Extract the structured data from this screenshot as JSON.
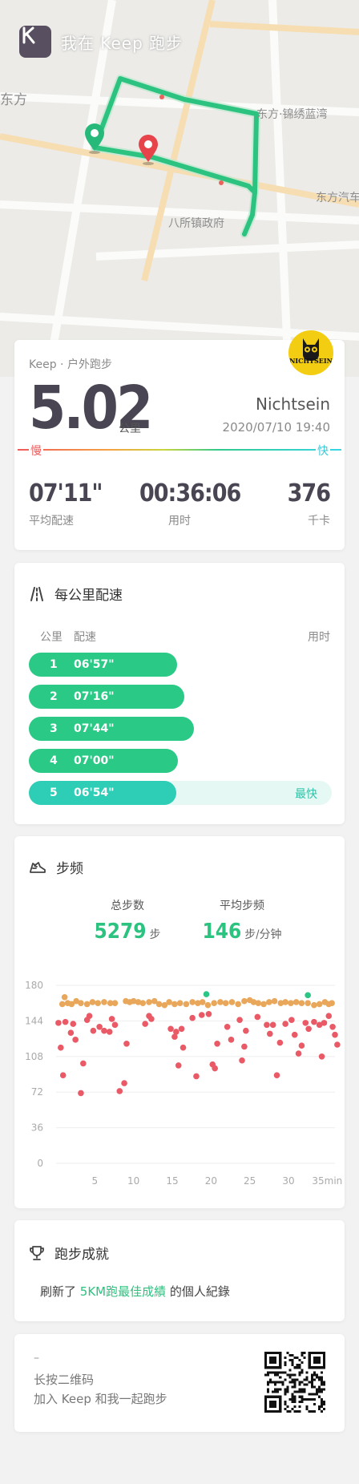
{
  "header": {
    "app_title": "我在 Keep 跑步",
    "map_labels": [
      "东方",
      "东方·锦绣蓝湾",
      "东方汽车",
      "八所镇政府"
    ]
  },
  "summary": {
    "source": "Keep · 户外跑步",
    "distance": "5.02",
    "distance_unit": "公里",
    "username": "Nichtsein",
    "avatar_text": "NICHTSEIN",
    "datetime": "2020/07/10 19:40",
    "slow_label": "慢",
    "fast_label": "快",
    "stats": [
      {
        "value": "07'11\"",
        "label": "平均配速"
      },
      {
        "value": "00:36:06",
        "label": "用时"
      },
      {
        "value": "376",
        "label": "千卡"
      }
    ]
  },
  "splits": {
    "title": "每公里配速",
    "col_km": "公里",
    "col_pace": "配速",
    "col_time": "用时",
    "fastest_label": "最快",
    "rows": [
      {
        "km": "1",
        "pace": "06'57\"",
        "pace_sec": 417
      },
      {
        "km": "2",
        "pace": "07'16\"",
        "pace_sec": 436
      },
      {
        "km": "3",
        "pace": "07'44\"",
        "pace_sec": 464
      },
      {
        "km": "4",
        "pace": "07'00\"",
        "pace_sec": 420
      },
      {
        "km": "5",
        "pace": "06'54\"",
        "pace_sec": 414
      }
    ]
  },
  "cadence": {
    "title": "步频",
    "total_steps_label": "总步数",
    "total_steps": "5279",
    "total_steps_unit": "步",
    "avg_cadence_label": "平均步频",
    "avg_cadence": "146",
    "avg_cadence_unit": "步/分钟"
  },
  "chart_data": {
    "type": "scatter",
    "title": "",
    "xlabel": "",
    "ylabel": "",
    "xlim": [
      0,
      36
    ],
    "ylim": [
      0,
      180
    ],
    "x_ticks": [
      {
        "v": 5,
        "label": "5"
      },
      {
        "v": 10,
        "label": "10"
      },
      {
        "v": 15,
        "label": "15"
      },
      {
        "v": 20,
        "label": "20"
      },
      {
        "v": 25,
        "label": "25"
      },
      {
        "v": 30,
        "label": "30"
      },
      {
        "v": 35,
        "label": "35min"
      }
    ],
    "y_ticks": [
      0,
      36,
      72,
      108,
      144,
      180
    ],
    "grid": true,
    "colors": {
      "high": "#2bc585",
      "normal": "#e8a75a",
      "low": "#ea5a66"
    },
    "series": [
      {
        "key": "high",
        "points": [
          [
            19.4,
            171
          ],
          [
            32.5,
            170
          ]
        ]
      },
      {
        "key": "normal",
        "points": [
          [
            0.8,
            161
          ],
          [
            1.1,
            168
          ],
          [
            1.5,
            162
          ],
          [
            2.0,
            161
          ],
          [
            2.6,
            164
          ],
          [
            3.2,
            162
          ],
          [
            4.0,
            161
          ],
          [
            4.7,
            163
          ],
          [
            5.4,
            162
          ],
          [
            6.2,
            163
          ],
          [
            7.0,
            162
          ],
          [
            7.6,
            162
          ],
          [
            9.0,
            164
          ],
          [
            9.5,
            163
          ],
          [
            10.0,
            164
          ],
          [
            10.6,
            163
          ],
          [
            11.2,
            162
          ],
          [
            12.0,
            163
          ],
          [
            12.7,
            164
          ],
          [
            13.3,
            161
          ],
          [
            14.0,
            160
          ],
          [
            14.6,
            163
          ],
          [
            15.3,
            161
          ],
          [
            16.0,
            162
          ],
          [
            16.8,
            161
          ],
          [
            17.6,
            163
          ],
          [
            18.3,
            162
          ],
          [
            18.9,
            163
          ],
          [
            19.6,
            160
          ],
          [
            20.4,
            162
          ],
          [
            21.2,
            163
          ],
          [
            21.9,
            162
          ],
          [
            22.7,
            163
          ],
          [
            23.5,
            161
          ],
          [
            24.3,
            164
          ],
          [
            25.0,
            165
          ],
          [
            25.5,
            163
          ],
          [
            26.1,
            162
          ],
          [
            26.8,
            161
          ],
          [
            27.5,
            163
          ],
          [
            28.2,
            164
          ],
          [
            29.0,
            162
          ],
          [
            29.6,
            163
          ],
          [
            30.3,
            162
          ],
          [
            31.0,
            163
          ],
          [
            31.7,
            162
          ],
          [
            32.5,
            162
          ],
          [
            33.3,
            160
          ],
          [
            34.0,
            161
          ],
          [
            34.7,
            163
          ],
          [
            35.2,
            161
          ],
          [
            35.6,
            162
          ]
        ]
      },
      {
        "key": "low",
        "points": [
          [
            0.3,
            142
          ],
          [
            0.6,
            117
          ],
          [
            0.9,
            89
          ],
          [
            1.2,
            143
          ],
          [
            1.9,
            132
          ],
          [
            2.2,
            141
          ],
          [
            2.5,
            125
          ],
          [
            3.2,
            71
          ],
          [
            3.5,
            101
          ],
          [
            4.0,
            145
          ],
          [
            4.3,
            149
          ],
          [
            4.8,
            134
          ],
          [
            5.6,
            138
          ],
          [
            6.2,
            134
          ],
          [
            6.9,
            133
          ],
          [
            7.2,
            146
          ],
          [
            7.6,
            140
          ],
          [
            8.2,
            73
          ],
          [
            8.8,
            81
          ],
          [
            9.1,
            121
          ],
          [
            11.5,
            141
          ],
          [
            12.0,
            149
          ],
          [
            12.3,
            146
          ],
          [
            14.8,
            136
          ],
          [
            15.3,
            128
          ],
          [
            15.5,
            133
          ],
          [
            15.8,
            99
          ],
          [
            16.2,
            136
          ],
          [
            16.4,
            117
          ],
          [
            17.6,
            147
          ],
          [
            18.8,
            150
          ],
          [
            18.1,
            88
          ],
          [
            19.7,
            151
          ],
          [
            20.2,
            100
          ],
          [
            20.5,
            96
          ],
          [
            20.8,
            121
          ],
          [
            22.1,
            138
          ],
          [
            22.6,
            125
          ],
          [
            23.7,
            145
          ],
          [
            24.0,
            104
          ],
          [
            24.3,
            118
          ],
          [
            24.5,
            134
          ],
          [
            26.0,
            148
          ],
          [
            27.2,
            140
          ],
          [
            27.6,
            131
          ],
          [
            28.0,
            140
          ],
          [
            28.5,
            89
          ],
          [
            28.9,
            122
          ],
          [
            29.6,
            141
          ],
          [
            30.4,
            145
          ],
          [
            30.8,
            130
          ],
          [
            31.3,
            111
          ],
          [
            31.7,
            119
          ],
          [
            32.2,
            142
          ],
          [
            32.6,
            136
          ],
          [
            33.3,
            143
          ],
          [
            34.0,
            140
          ],
          [
            34.3,
            108
          ],
          [
            34.6,
            142
          ],
          [
            35.2,
            149
          ],
          [
            35.7,
            138
          ],
          [
            36.0,
            130
          ],
          [
            36.3,
            120
          ]
        ]
      }
    ]
  },
  "achievement": {
    "title": "跑步成就",
    "text_pre": "刷新了 ",
    "text_highlight": "5KM跑最佳成績",
    "text_post": " 的個人紀錄"
  },
  "share": {
    "dash": "–",
    "line1": "长按二维码",
    "line2": "加入 Keep 和我一起跑步"
  }
}
